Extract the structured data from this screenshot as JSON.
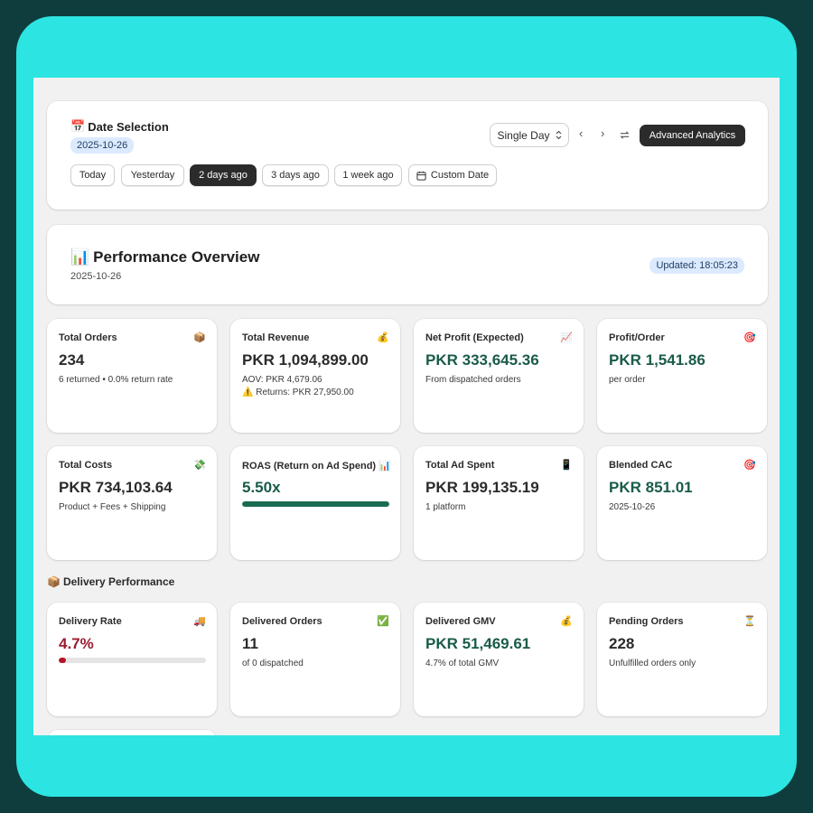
{
  "date_selection": {
    "icon": "calendar-icon",
    "title": "Date Selection",
    "selected_date": "2025-10-26",
    "quick_buttons": [
      "Today",
      "Yesterday",
      "2 days ago",
      "3 days ago",
      "1 week ago"
    ],
    "active_button": "2 days ago",
    "custom_date_label": "Custom Date",
    "mode_select": "Single Day",
    "advanced_label": "Advanced Analytics"
  },
  "overview": {
    "icon": "bar-chart-icon",
    "title": "Performance Overview",
    "date": "2025-10-26",
    "updated": "Updated: 18:05:23"
  },
  "metrics": [
    {
      "label": "Total Orders",
      "icon": "📦",
      "value": "234",
      "sub": "6 returned • 0.0% return rate"
    },
    {
      "label": "Total Revenue",
      "icon": "💰",
      "value": "PKR 1,094,899.00",
      "sub": "AOV: PKR 4,679.06",
      "sub2": "⚠️ Returns: PKR 27,950.00"
    },
    {
      "label": "Net Profit (Expected)",
      "icon": "📈",
      "value": "PKR 333,645.36",
      "sub": "From dispatched orders"
    },
    {
      "label": "Profit/Order",
      "icon": "🎯",
      "value": "PKR 1,541.86",
      "sub": "per order"
    },
    {
      "label": "Total Costs",
      "icon": "💸",
      "value": "PKR 734,103.64",
      "sub": "Product + Fees + Shipping"
    },
    {
      "label": "ROAS (Return on Ad Spend) 📊",
      "icon": "",
      "value": "5.50x",
      "progress": 1.0
    },
    {
      "label": "Total Ad Spent",
      "icon": "📱",
      "value": "PKR 199,135.19",
      "sub": "1 platform"
    },
    {
      "label": "Blended CAC",
      "icon": "🎯",
      "value": "PKR 851.01",
      "sub": "2025-10-26"
    }
  ],
  "delivery": {
    "title": "Delivery Performance",
    "icon": "📦",
    "metrics": [
      {
        "label": "Delivery Rate",
        "icon": "🚚",
        "value": "4.7%",
        "progress": 0.047
      },
      {
        "label": "Delivered Orders",
        "icon": "✅",
        "value": "11",
        "sub": "of 0 dispatched"
      },
      {
        "label": "Delivered GMV",
        "icon": "💰",
        "value": "PKR 51,469.61",
        "sub": "4.7% of total GMV"
      },
      {
        "label": "Pending Orders",
        "icon": "⏳",
        "value": "228",
        "sub": "Unfulfilled orders only"
      }
    ]
  },
  "colors": {
    "frame": "#2ce4e2",
    "background": "#0f3d3e",
    "green_value": "#1a5b4a",
    "red_value": "#9b1c31",
    "badge_bg": "#dbeafe",
    "dark_button": "#2b2b2b"
  }
}
